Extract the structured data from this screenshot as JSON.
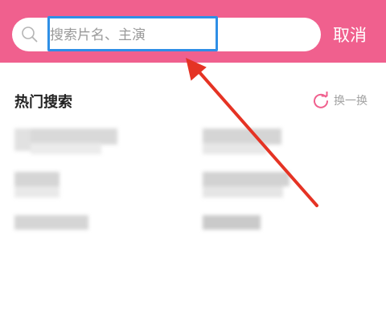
{
  "search": {
    "placeholder": "搜索片名、主演",
    "cancel_label": "取消"
  },
  "hot": {
    "title": "热门搜索",
    "refresh_label": "换一换"
  },
  "colors": {
    "topbar": "#f0608e",
    "highlight": "#2f8fe6",
    "arrow": "#e53324"
  },
  "icons": [
    "search-icon",
    "refresh-icon",
    "annotation-arrow-icon"
  ]
}
